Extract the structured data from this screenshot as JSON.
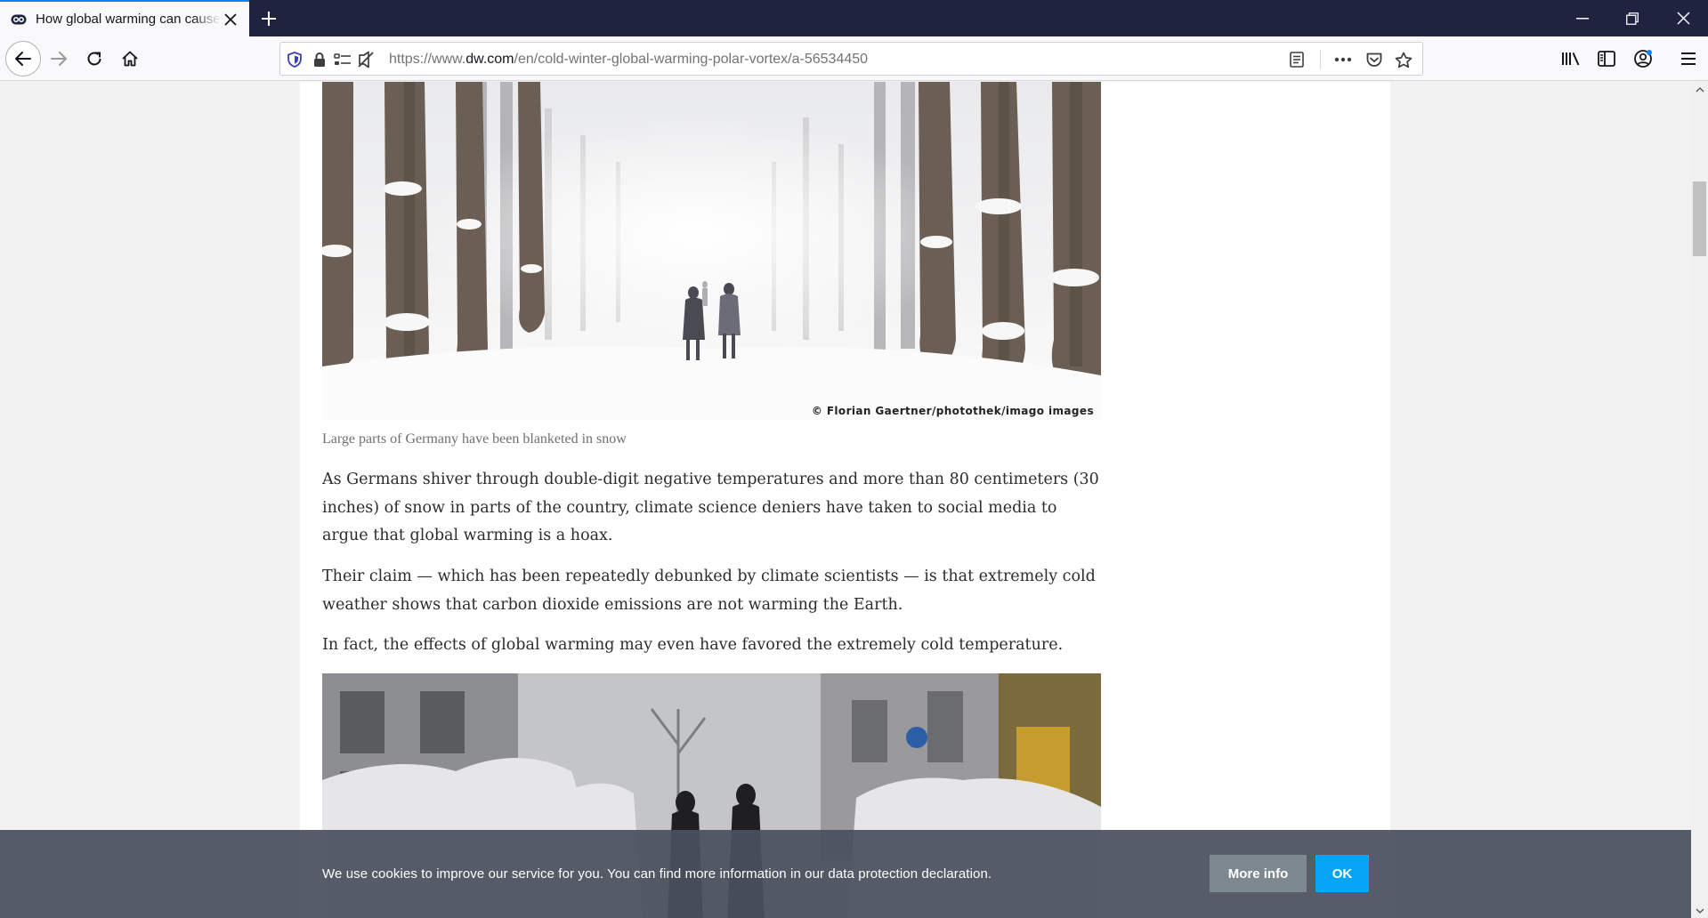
{
  "browser": {
    "tab_title": "How global warming can cause",
    "url_prefix": "https://www.",
    "url_host": "dw.com",
    "url_path": "/en/cold-winter-global-warming-polar-vortex/a-56534450"
  },
  "article": {
    "photo1_credit": "© Florian Gaertner/photothek/imago images",
    "photo1_caption": "Large parts of Germany have been blanketed in snow",
    "paragraphs": [
      "As Germans shiver through double-digit negative temperatures and more than 80 centimeters (30 inches) of snow in parts of the country, climate science deniers have taken to social media to argue that global warming is a hoax.",
      "Their claim — which has been repeatedly debunked by climate scientists — is that extremely cold weather shows that carbon dioxide emissions are not warming the Earth.",
      "In fact, the effects of global warming may even have favored the extremely cold temperature."
    ]
  },
  "cookie_banner": {
    "text": "We use cookies to improve our service for you. You can find more information in our data protection declaration.",
    "more_info_label": "More info",
    "ok_label": "OK"
  },
  "colors": {
    "tabbar": "#1f2340",
    "accent": "#0a84ff",
    "ok_button": "#05a4f5",
    "banner": "#49515c"
  }
}
